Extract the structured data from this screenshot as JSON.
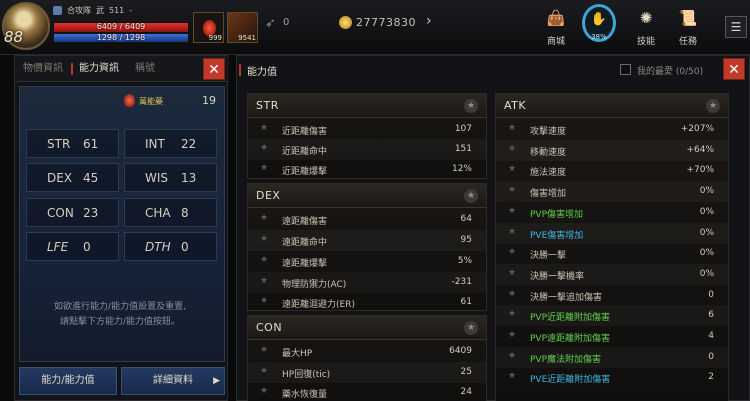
{
  "hud": {
    "level": "88",
    "status_items": [
      "合攻隊",
      "武",
      "511",
      "-"
    ],
    "hp": {
      "label": "6409 / 6409",
      "fraction": 1.0
    },
    "mp": {
      "label": "1298 / 1298",
      "fraction": 1.0
    },
    "potion_count": "999",
    "item_count": "9541",
    "arrow_count": "0",
    "gold": "27773830",
    "menu": [
      {
        "icon": "bag-icon",
        "label": "商城"
      },
      {
        "icon": "ring-icon",
        "label": "38%"
      },
      {
        "icon": "skill-icon",
        "label": "技能"
      },
      {
        "icon": "quest-icon",
        "label": "任務"
      }
    ]
  },
  "left_panel": {
    "tabs": [
      "物價資訊",
      "能力資訊",
      "稱號"
    ],
    "active_tab": 1,
    "elixir_label": "萬能藥",
    "elixir_value": "19",
    "stats": [
      {
        "key": "STR",
        "value": "61"
      },
      {
        "key": "INT",
        "value": "22"
      },
      {
        "key": "DEX",
        "value": "45"
      },
      {
        "key": "WIS",
        "value": "13"
      },
      {
        "key": "CON",
        "value": "23"
      },
      {
        "key": "CHA",
        "value": "8"
      },
      {
        "key": "LFE",
        "value": "0"
      },
      {
        "key": "DTH",
        "value": "0"
      }
    ],
    "hint_lines": [
      "如欲進行能力/能力值設置及重置,",
      "請點擊下方能力/能力值按鈕。"
    ],
    "buttons": {
      "ability": "能力/能力值",
      "detail": "詳細資料"
    }
  },
  "right_panel": {
    "title": "能力值",
    "checkbox_label": "我的最愛 (0/50)",
    "sections": {
      "str": {
        "title": "STR",
        "rows": [
          {
            "name": "近距離傷害",
            "value": "107"
          },
          {
            "name": "近距離命中",
            "value": "151"
          },
          {
            "name": "近距離爆擊",
            "value": "12%"
          }
        ]
      },
      "dex": {
        "title": "DEX",
        "rows": [
          {
            "name": "遠距離傷害",
            "value": "64"
          },
          {
            "name": "遠距離命中",
            "value": "95"
          },
          {
            "name": "遠距離爆擊",
            "value": "5%"
          },
          {
            "name": "物理防禦力(AC)",
            "value": "-231"
          },
          {
            "name": "遠距離迴避力(ER)",
            "value": "61"
          }
        ]
      },
      "con": {
        "title": "CON",
        "rows": [
          {
            "name": "最大HP",
            "value": "6409"
          },
          {
            "name": "HP回復(tic)",
            "value": "25"
          },
          {
            "name": "藥水恢復量",
            "value": "24"
          }
        ]
      },
      "atk": {
        "title": "ATK",
        "rows": [
          {
            "name": "攻擊速度",
            "value": "+207%",
            "color": "normal"
          },
          {
            "name": "移動速度",
            "value": "+64%",
            "color": "normal"
          },
          {
            "name": "施法速度",
            "value": "+70%",
            "color": "normal"
          },
          {
            "name": "傷害增加",
            "value": "0%",
            "color": "normal"
          },
          {
            "name": "PVP傷害增加",
            "value": "0%",
            "color": "green"
          },
          {
            "name": "PVE傷害增加",
            "value": "0%",
            "color": "cyan"
          },
          {
            "name": "決勝一擊",
            "value": "0%",
            "color": "normal"
          },
          {
            "name": "決勝一擊機率",
            "value": "0%",
            "color": "normal"
          },
          {
            "name": "決勝一擊追加傷害",
            "value": "0",
            "color": "normal"
          },
          {
            "name": "PVP近距離附加傷害",
            "value": "6",
            "color": "green"
          },
          {
            "name": "PVP遠距離附加傷害",
            "value": "4",
            "color": "green"
          },
          {
            "name": "PVP魔法附加傷害",
            "value": "0",
            "color": "green"
          },
          {
            "name": "PVE近距離附加傷害",
            "value": "2",
            "color": "cyan"
          }
        ]
      }
    }
  }
}
